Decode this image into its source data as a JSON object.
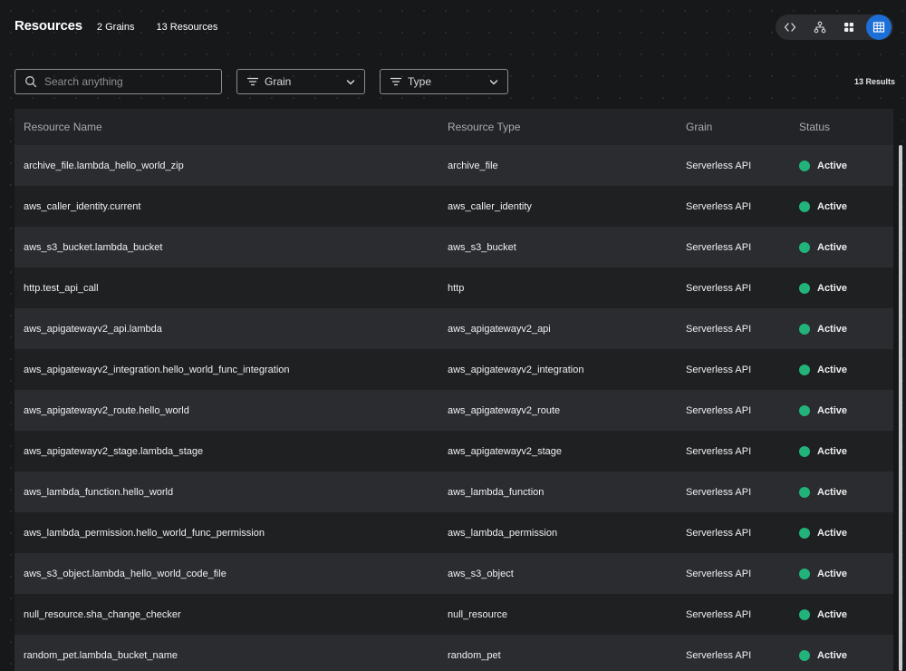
{
  "header": {
    "title": "Resources",
    "grains_count": "2 Grains",
    "resources_count": "13 Resources"
  },
  "view_switch": {
    "options": [
      "code-view",
      "graph-view",
      "grid-view",
      "table-view"
    ],
    "active": "table-view"
  },
  "toolbar": {
    "search_placeholder": "Search anything",
    "search_value": "",
    "grain_filter_label": "Grain",
    "type_filter_label": "Type",
    "results_label": "13 Results"
  },
  "table": {
    "columns": [
      "Resource Name",
      "Resource Type",
      "Grain",
      "Status"
    ],
    "rows": [
      {
        "name": "archive_file.lambda_hello_world_zip",
        "type": "archive_file",
        "grain": "Serverless API",
        "status": "Active"
      },
      {
        "name": "aws_caller_identity.current",
        "type": "aws_caller_identity",
        "grain": "Serverless API",
        "status": "Active"
      },
      {
        "name": "aws_s3_bucket.lambda_bucket",
        "type": "aws_s3_bucket",
        "grain": "Serverless API",
        "status": "Active"
      },
      {
        "name": "http.test_api_call",
        "type": "http",
        "grain": "Serverless API",
        "status": "Active"
      },
      {
        "name": "aws_apigatewayv2_api.lambda",
        "type": "aws_apigatewayv2_api",
        "grain": "Serverless API",
        "status": "Active"
      },
      {
        "name": "aws_apigatewayv2_integration.hello_world_func_integration",
        "type": "aws_apigatewayv2_integration",
        "grain": "Serverless API",
        "status": "Active"
      },
      {
        "name": "aws_apigatewayv2_route.hello_world",
        "type": "aws_apigatewayv2_route",
        "grain": "Serverless API",
        "status": "Active"
      },
      {
        "name": "aws_apigatewayv2_stage.lambda_stage",
        "type": "aws_apigatewayv2_stage",
        "grain": "Serverless API",
        "status": "Active"
      },
      {
        "name": "aws_lambda_function.hello_world",
        "type": "aws_lambda_function",
        "grain": "Serverless API",
        "status": "Active"
      },
      {
        "name": "aws_lambda_permission.hello_world_func_permission",
        "type": "aws_lambda_permission",
        "grain": "Serverless API",
        "status": "Active"
      },
      {
        "name": "aws_s3_object.lambda_hello_world_code_file",
        "type": "aws_s3_object",
        "grain": "Serverless API",
        "status": "Active"
      },
      {
        "name": "null_resource.sha_change_checker",
        "type": "null_resource",
        "grain": "Serverless API",
        "status": "Active"
      },
      {
        "name": "random_pet.lambda_bucket_name",
        "type": "random_pet",
        "grain": "Serverless API",
        "status": "Active"
      }
    ]
  },
  "colors": {
    "background": "#17181a",
    "accent": "#1c6fd6",
    "status_active": "#22b37a"
  }
}
